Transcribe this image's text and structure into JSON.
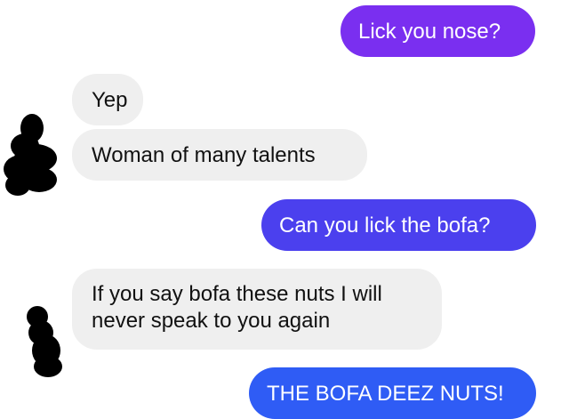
{
  "colors": {
    "outgoing_top": "#7a2ff0",
    "outgoing_mid": "#4b40ee",
    "outgoing_bottom": "#2f5cf5",
    "incoming_bg": "#efefef",
    "avatar_redacted": "#000000"
  },
  "messages": [
    {
      "side": "outgoing",
      "text": "Lick you nose?"
    },
    {
      "side": "incoming",
      "text": "Yep"
    },
    {
      "side": "incoming",
      "text": "Woman of many talents"
    },
    {
      "side": "outgoing",
      "text": "Can you lick the bofa?"
    },
    {
      "side": "incoming",
      "text": "If you say bofa these nuts I will never speak to you again"
    },
    {
      "side": "outgoing",
      "text": "THE BOFA DEEZ NUTS!"
    }
  ]
}
